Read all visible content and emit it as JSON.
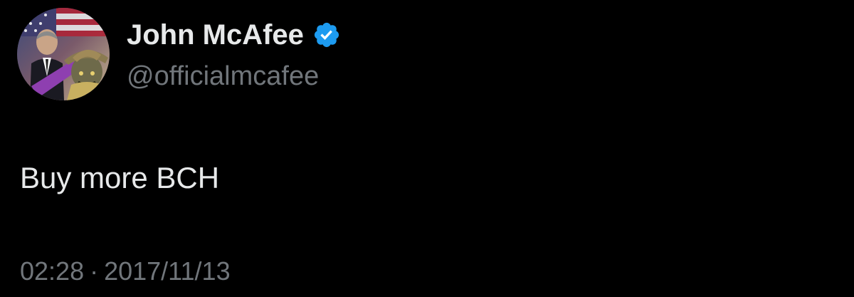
{
  "author": {
    "display_name": "John McAfee",
    "handle": "@officialmcafee",
    "verified": true,
    "avatar_icon": "profile-avatar",
    "verified_icon": "verified-badge-icon",
    "verified_color": "#1d9bf0"
  },
  "tweet": {
    "text": "Buy more BCH"
  },
  "meta": {
    "time": "02:28",
    "separator": "·",
    "date": "2017/11/13"
  },
  "colors": {
    "background": "#000000",
    "primary_text": "#e7e9ea",
    "secondary_text": "#71767b"
  }
}
